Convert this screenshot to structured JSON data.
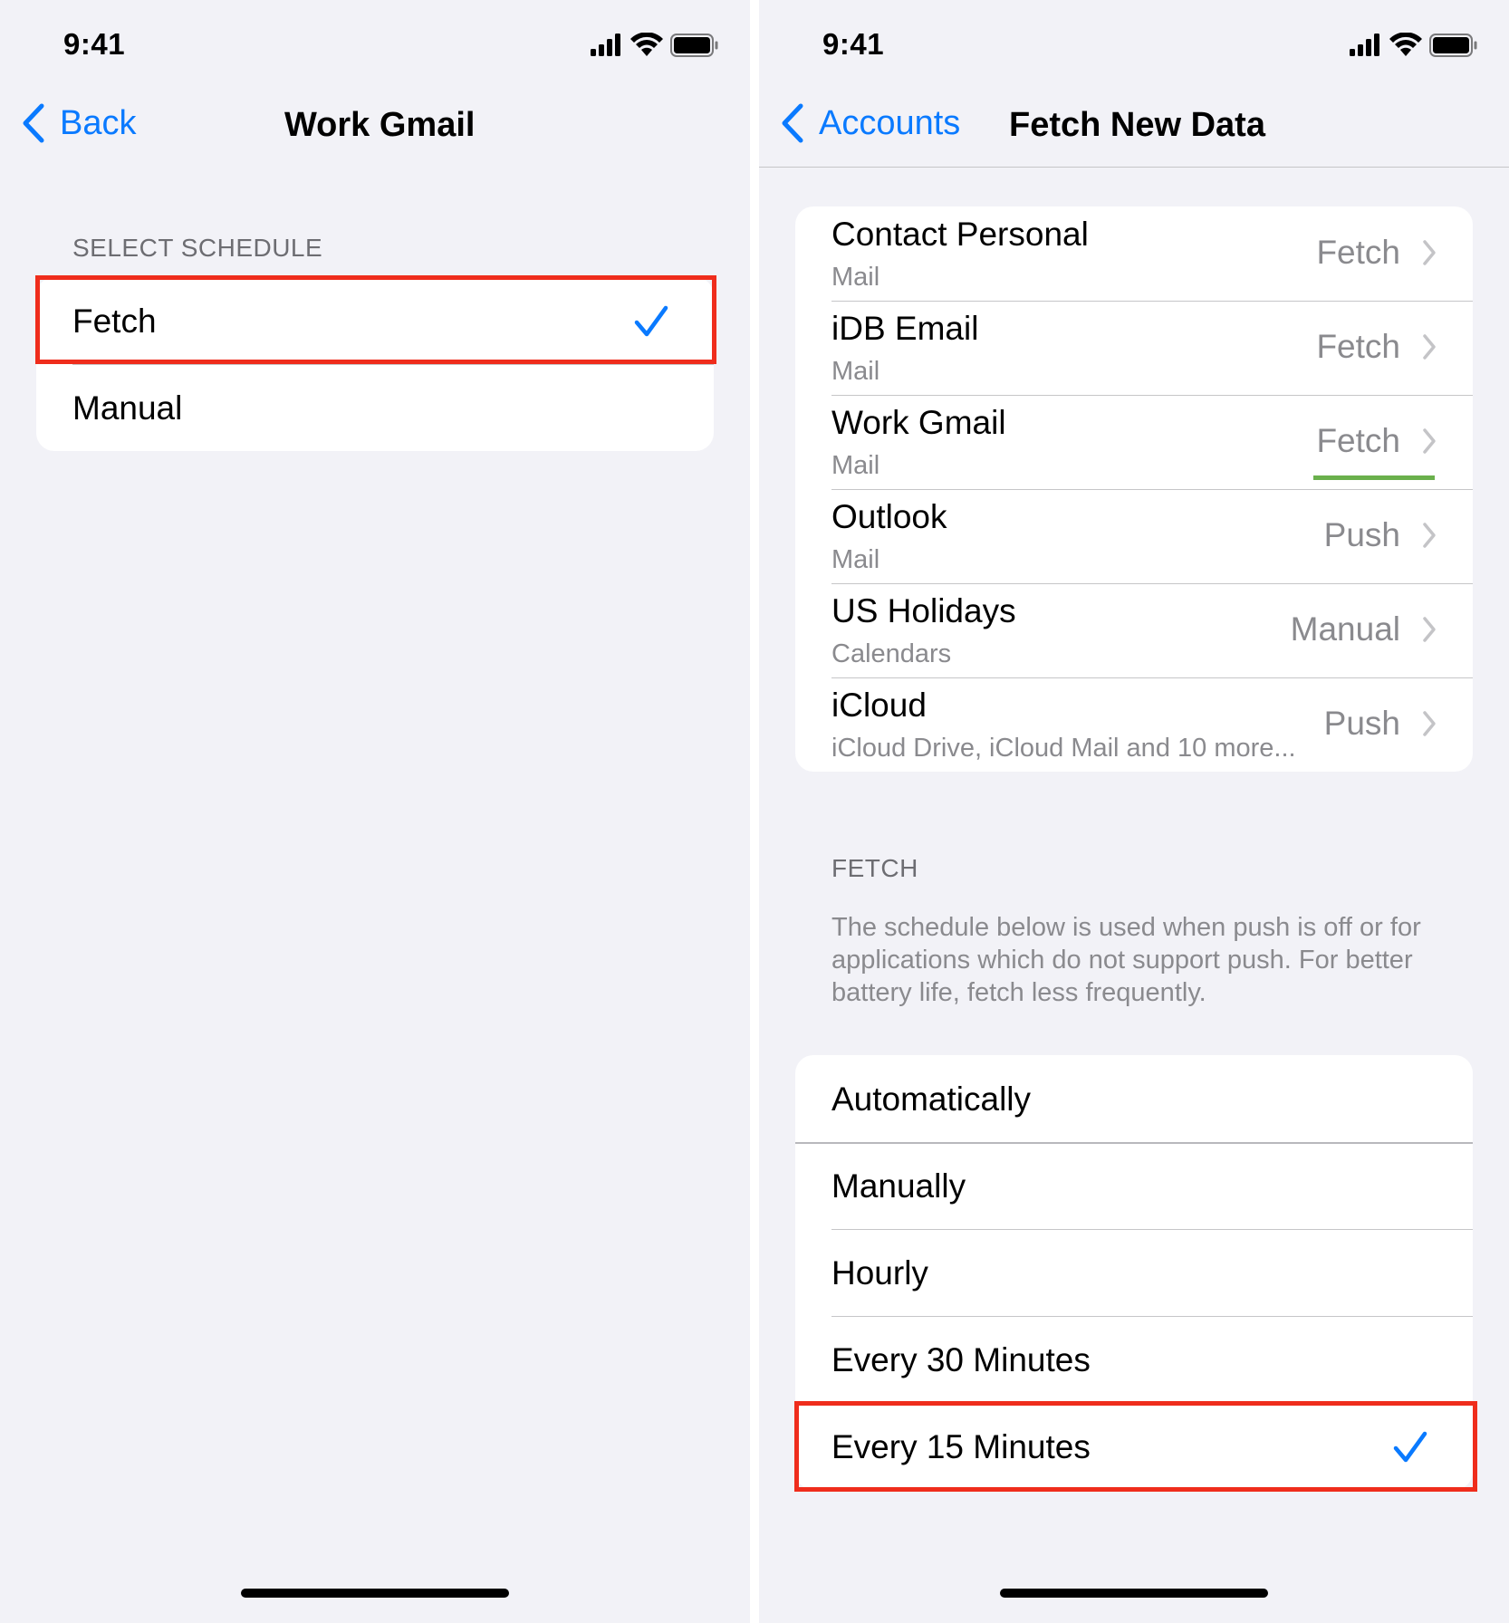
{
  "left_screen": {
    "status_time": "9:41",
    "nav": {
      "back_label": "Back",
      "title": "Work Gmail"
    },
    "section_header": "SELECT SCHEDULE",
    "options": [
      {
        "label": "Fetch",
        "selected": true
      },
      {
        "label": "Manual",
        "selected": false
      }
    ]
  },
  "right_screen": {
    "status_time": "9:41",
    "nav": {
      "back_label": "Accounts",
      "title": "Fetch New Data"
    },
    "accounts": [
      {
        "name": "Contact Personal",
        "type": "Mail",
        "value": "Fetch"
      },
      {
        "name": "iDB Email",
        "type": "Mail",
        "value": "Fetch"
      },
      {
        "name": "Work Gmail",
        "type": "Mail",
        "value": "Fetch"
      },
      {
        "name": "Outlook",
        "type": "Mail",
        "value": "Push"
      },
      {
        "name": "US Holidays",
        "type": "Calendars",
        "value": "Manual"
      },
      {
        "name": "iCloud",
        "type": "iCloud Drive, iCloud Mail and 10 more...",
        "value": "Push"
      }
    ],
    "fetch_header": "FETCH",
    "fetch_description": "The schedule below is used when push is off or for applications which do not support push. For better battery life, fetch less frequently.",
    "schedule_options": [
      {
        "label": "Automatically",
        "selected": false
      },
      {
        "label": "Manually",
        "selected": false
      },
      {
        "label": "Hourly",
        "selected": false
      },
      {
        "label": "Every 30 Minutes",
        "selected": false
      },
      {
        "label": "Every 15 Minutes",
        "selected": true
      }
    ]
  },
  "colors": {
    "accent": "#0a7aff",
    "highlight": "#ef2d1c",
    "underline": "#6ab04c",
    "background": "#f2f2f7"
  },
  "icons": [
    "signal-icon",
    "wifi-icon",
    "battery-icon",
    "chevron-left-icon",
    "chevron-right-icon",
    "checkmark-icon"
  ]
}
